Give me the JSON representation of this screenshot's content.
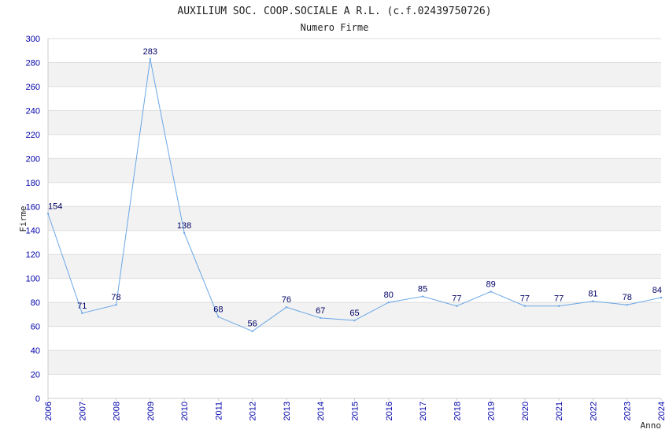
{
  "chart_data": {
    "type": "line",
    "title": "AUXILIUM SOC. COOP.SOCIALE A R.L. (c.f.02439750726)",
    "subtitle": "Numero Firme",
    "xlabel": "Anno",
    "ylabel": "Firme",
    "ylim": [
      0,
      300
    ],
    "yticks": [
      0,
      20,
      40,
      60,
      80,
      100,
      120,
      140,
      160,
      180,
      200,
      220,
      240,
      260,
      280,
      300
    ],
    "x": [
      "2006",
      "2007",
      "2008",
      "2009",
      "2010",
      "2011",
      "2012",
      "2013",
      "2014",
      "2015",
      "2016",
      "2017",
      "2018",
      "2019",
      "2020",
      "2021",
      "2022",
      "2023",
      "2024"
    ],
    "series": [
      {
        "values": [
          154,
          71,
          78,
          283,
          138,
          68,
          56,
          76,
          67,
          65,
          80,
          85,
          77,
          89,
          77,
          77,
          81,
          78,
          84
        ]
      }
    ],
    "colors": {
      "line": "#6aa7e6",
      "band": "#f2f2f2",
      "grid": "#dddddd",
      "tick": "#0000aa",
      "label": "#000066"
    },
    "grid": true,
    "legend": "none"
  }
}
